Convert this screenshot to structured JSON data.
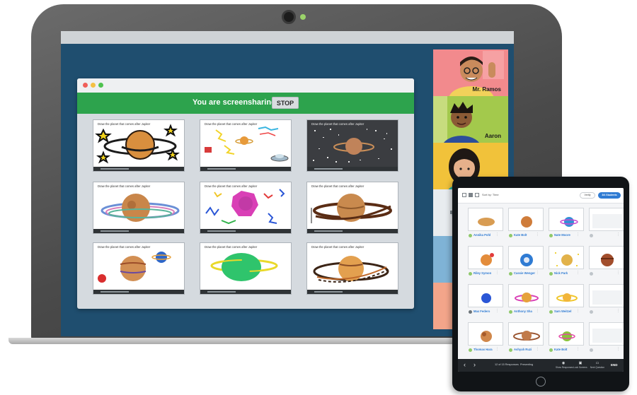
{
  "screenshare": {
    "banner_text": "You are screensharing",
    "stop_label": "STOP",
    "slide_prompt": "Draw the planet that comes after Jupiter"
  },
  "video_call": {
    "participants": [
      {
        "name": "Mr. Ramos"
      },
      {
        "name": "Aaron"
      },
      {
        "name": ""
      }
    ]
  },
  "tablet": {
    "sort_label": "Sort by: Time",
    "verify_label": "Verify",
    "students_label": "3/4 Students",
    "cards": [
      {
        "name": "Annika Pohl"
      },
      {
        "name": "Kate Bolt"
      },
      {
        "name": "Nate Moore"
      },
      {
        "name": "Riley Symon"
      },
      {
        "name": "Cassie Wenger"
      },
      {
        "name": "Nick Park"
      },
      {
        "name": "Max Federo"
      },
      {
        "name": "Anthony Sha"
      },
      {
        "name": "Sam Weitzel"
      },
      {
        "name": "Thomas Hara"
      },
      {
        "name": "Ashyah Ruzi"
      },
      {
        "name": "Kate Bolt"
      }
    ],
    "bottom_bar": {
      "responses": "12 of 15 Responses",
      "presenting": "Presenting",
      "tools": [
        {
          "label": "Show Responses",
          "icon": "eye-icon"
        },
        {
          "label": "Lock Screens",
          "icon": "lock-icon"
        },
        {
          "label": "Next Question",
          "icon": "message-icon"
        }
      ],
      "end_label": "END"
    }
  },
  "colors": {
    "share_banner": "#2da34d",
    "screen_bg": "#1f4e6f",
    "accent_blue": "#2f7bd3"
  }
}
